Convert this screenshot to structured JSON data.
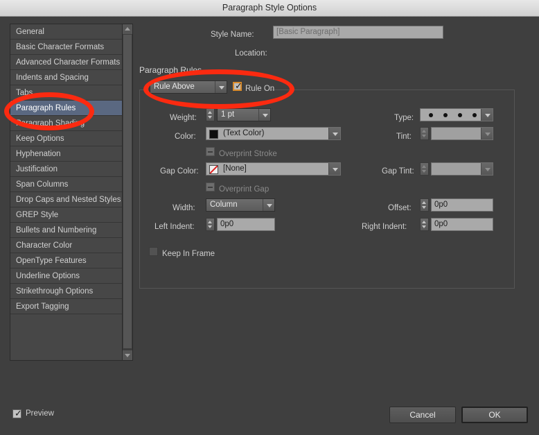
{
  "window": {
    "title": "Paragraph Style Options"
  },
  "sidebar": {
    "items": [
      {
        "label": "General",
        "selected": false
      },
      {
        "label": "Basic Character Formats",
        "selected": false
      },
      {
        "label": "Advanced Character Formats",
        "selected": false
      },
      {
        "label": "Indents and Spacing",
        "selected": false
      },
      {
        "label": "Tabs",
        "selected": false
      },
      {
        "label": "Paragraph Rules",
        "selected": true
      },
      {
        "label": "Paragraph Shading",
        "selected": false
      },
      {
        "label": "Keep Options",
        "selected": false
      },
      {
        "label": "Hyphenation",
        "selected": false
      },
      {
        "label": "Justification",
        "selected": false
      },
      {
        "label": "Span Columns",
        "selected": false
      },
      {
        "label": "Drop Caps and Nested Styles",
        "selected": false
      },
      {
        "label": "GREP Style",
        "selected": false
      },
      {
        "label": "Bullets and Numbering",
        "selected": false
      },
      {
        "label": "Character Color",
        "selected": false
      },
      {
        "label": "OpenType Features",
        "selected": false
      },
      {
        "label": "Underline Options",
        "selected": false
      },
      {
        "label": "Strikethrough Options",
        "selected": false
      },
      {
        "label": "Export Tagging",
        "selected": false
      }
    ]
  },
  "header": {
    "style_name_label": "Style Name:",
    "style_name_value": "[Basic Paragraph]",
    "location_label": "Location:",
    "location_value": ""
  },
  "section": {
    "title": "Paragraph Rules",
    "rule_position_value": "Rule Above",
    "rule_on_label": "Rule On",
    "rule_on_checked": true
  },
  "fields": {
    "weight_label": "Weight:",
    "weight_value": "1 pt",
    "color_label": "Color:",
    "color_value": "(Text Color)",
    "color_swatch": "#0d0d0d",
    "overprint_stroke_label": "Overprint Stroke",
    "gap_color_label": "Gap Color:",
    "gap_color_value": "[None]",
    "overprint_gap_label": "Overprint Gap",
    "width_label": "Width:",
    "width_value": "Column",
    "left_indent_label": "Left Indent:",
    "left_indent_value": "0p0",
    "type_label": "Type:",
    "type_value": "dotted",
    "tint_label": "Tint:",
    "tint_value": "",
    "gap_tint_label": "Gap Tint:",
    "gap_tint_value": "",
    "offset_label": "Offset:",
    "offset_value": "0p0",
    "right_indent_label": "Right Indent:",
    "right_indent_value": "0p0",
    "keep_in_frame_label": "Keep In Frame",
    "keep_in_frame_checked": false
  },
  "footer": {
    "preview_label": "Preview",
    "preview_checked": true,
    "cancel_label": "Cancel",
    "ok_label": "OK"
  },
  "annotations": {
    "accent_color": "#fb2a10",
    "highlight_color": "#d98b2b"
  }
}
